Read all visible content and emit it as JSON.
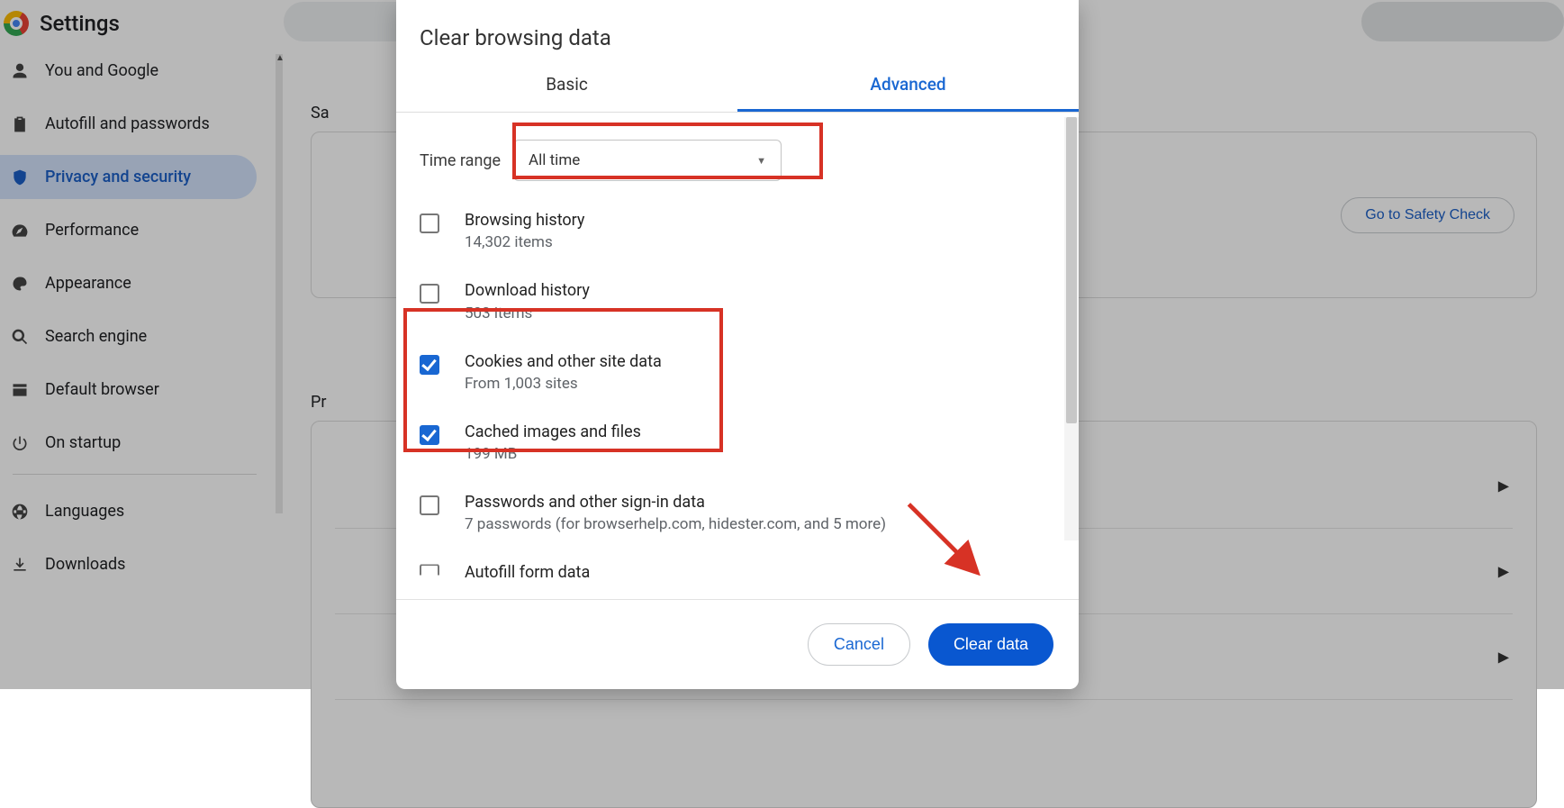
{
  "page": {
    "title": "Settings",
    "section_safety": "Sa",
    "section_privacy": "Pr",
    "safety_check_btn": "Go to Safety Check"
  },
  "sidebar": {
    "items": [
      {
        "label": "You and Google"
      },
      {
        "label": "Autofill and passwords"
      },
      {
        "label": "Privacy and security"
      },
      {
        "label": "Performance"
      },
      {
        "label": "Appearance"
      },
      {
        "label": "Search engine"
      },
      {
        "label": "Default browser"
      },
      {
        "label": "On startup"
      },
      {
        "label": "Languages"
      },
      {
        "label": "Downloads"
      }
    ]
  },
  "dialog": {
    "title": "Clear browsing data",
    "tabs": {
      "basic": "Basic",
      "advanced": "Advanced"
    },
    "time_range_label": "Time range",
    "time_range_value": "All time",
    "items": [
      {
        "title": "Browsing history",
        "subtitle": "14,302 items",
        "checked": false
      },
      {
        "title": "Download history",
        "subtitle": "503 items",
        "checked": false
      },
      {
        "title": "Cookies and other site data",
        "subtitle": "From 1,003 sites",
        "checked": true
      },
      {
        "title": "Cached images and files",
        "subtitle": "199 MB",
        "checked": true
      },
      {
        "title": "Passwords and other sign-in data",
        "subtitle": "7 passwords (for browserhelp.com, hidester.com, and 5 more)",
        "checked": false
      },
      {
        "title": "Autofill form data",
        "subtitle": "",
        "checked": false
      }
    ],
    "cancel": "Cancel",
    "clear": "Clear data"
  }
}
